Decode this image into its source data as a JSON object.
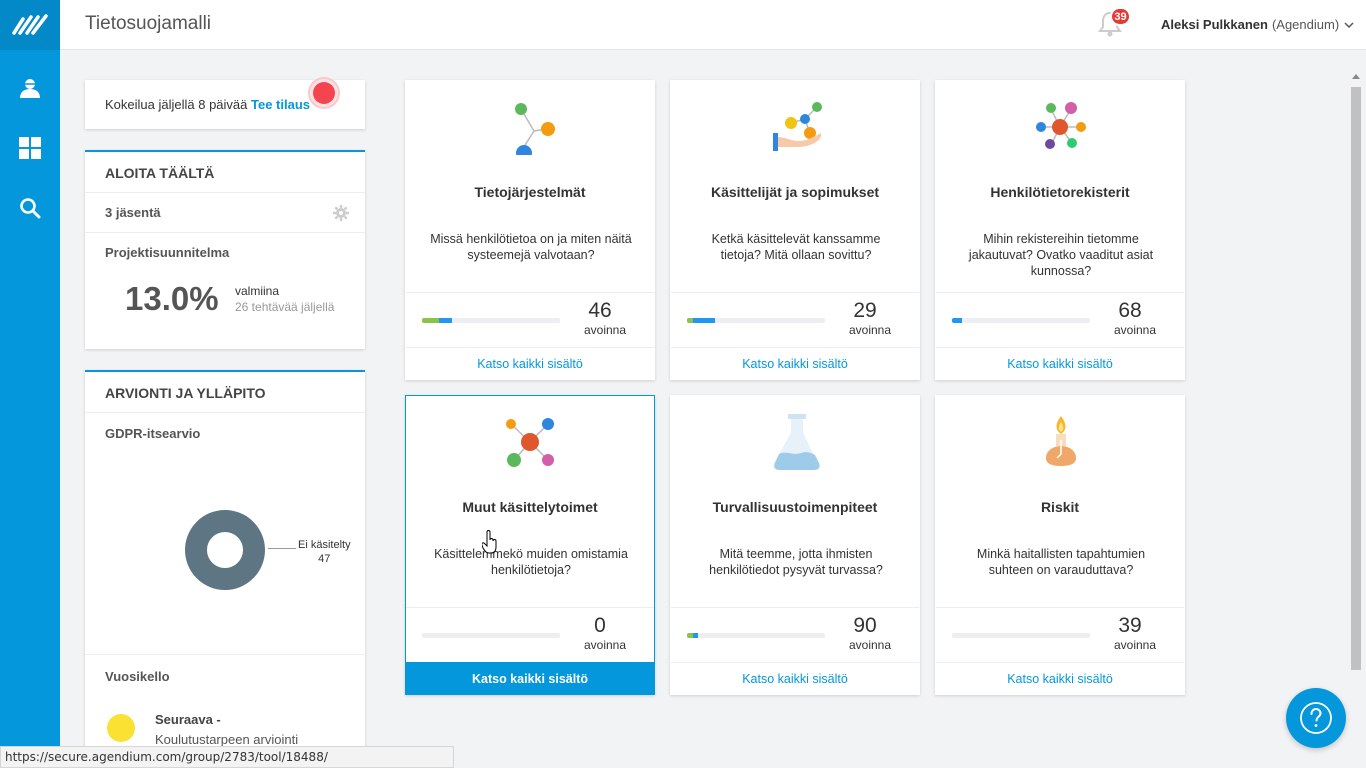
{
  "app": {
    "title": "Tietosuojamalli"
  },
  "notifications": {
    "count": "39"
  },
  "user": {
    "name": "Aleksi Pulkkanen",
    "org": "(Agendium)"
  },
  "rail": {
    "items": [
      "logo-icon",
      "user-icon",
      "dashboard-icon",
      "search-icon"
    ]
  },
  "trial": {
    "text": "Kokeilua jäljellä 8 päivää",
    "link": "Tee tilaus"
  },
  "start": {
    "heading": "ALOITA TÄÄLTÄ",
    "members": "3 jäsentä",
    "project_title": "Projektisuunnitelma",
    "percent": "13.0%",
    "ready": "valmiina",
    "tasks_left": "26 tehtävää jäljellä"
  },
  "review": {
    "heading": "ARVIONTI JA YLLÄPITO",
    "gdpr": "GDPR-itsearvio",
    "donut_label": "Ei käsitelty",
    "donut_value": "47",
    "donut_color": "#5e7683",
    "yearclock": "Vuosikello",
    "next_label": "Seuraava -",
    "next_item": "Koulutustarpeen arviointi"
  },
  "cards": [
    {
      "title": "Tietojärjestelmät",
      "desc": "Missä henkilötietoa on ja miten näitä systeemejä valvotaan?",
      "count": "46",
      "open": "avoinna",
      "link": "Katso kaikki sisältö",
      "progress": [
        {
          "color": "#8bc34a",
          "pct": 12
        },
        {
          "color": "#2196f3",
          "pct": 10
        }
      ]
    },
    {
      "title": "Käsittelijät ja sopimukset",
      "desc": "Ketkä käsittelevät kanssamme tietoja? Mitä ollaan sovittu?",
      "count": "29",
      "open": "avoinna",
      "link": "Katso kaikki sisältö",
      "progress": [
        {
          "color": "#8bc34a",
          "pct": 4
        },
        {
          "color": "#2196f3",
          "pct": 16
        }
      ]
    },
    {
      "title": "Henkilötietorekisterit",
      "desc": "Mihin rekistereihin tietomme jakautuvat? Ovatko vaaditut asiat kunnossa?",
      "count": "68",
      "open": "avoinna",
      "link": "Katso kaikki sisältö",
      "progress": [
        {
          "color": "#2196f3",
          "pct": 7
        }
      ]
    },
    {
      "title": "Muut käsittelytoimet",
      "desc": "Käsittelemmekö muiden omistamia henkilötietoja?",
      "count": "0",
      "open": "avoinna",
      "link": "Katso kaikki sisältö",
      "progress": []
    },
    {
      "title": "Turvallisuustoimenpiteet",
      "desc": "Mitä teemme, jotta ihmisten henkilötiedot pysyvät turvassa?",
      "count": "90",
      "open": "avoinna",
      "link": "Katso kaikki sisältö",
      "progress": [
        {
          "color": "#8bc34a",
          "pct": 4
        },
        {
          "color": "#2196f3",
          "pct": 4
        }
      ]
    },
    {
      "title": "Riskit",
      "desc": "Minkä haitallisten tapahtumien suhteen on varauduttava?",
      "count": "39",
      "open": "avoinna",
      "link": "Katso kaikki sisältö",
      "progress": []
    }
  ],
  "status_url": "https://secure.agendium.com/group/2783/tool/18488/",
  "colors": {
    "accent": "#0497dc",
    "alert": "#e53935"
  }
}
